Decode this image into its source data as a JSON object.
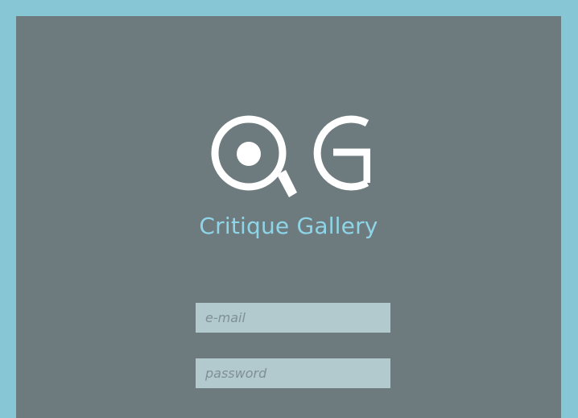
{
  "brand": {
    "logo_icon": "critique-gallery-magnifier-logo",
    "name": "Critique Gallery"
  },
  "login": {
    "email_placeholder": "e-mail",
    "email_value": "",
    "password_placeholder": "password",
    "password_value": ""
  },
  "colors": {
    "page_border": "#87c6d4",
    "panel": "#6e7b7e",
    "accent": "#8ed5e7",
    "field_bg": "#b2c9cd",
    "logo": "#ffffff"
  }
}
